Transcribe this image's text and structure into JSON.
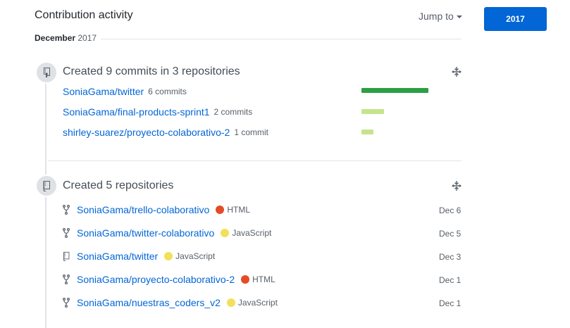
{
  "header": {
    "title": "Contribution activity",
    "jump_label": "Jump to",
    "year_button": "2017"
  },
  "month": {
    "name": "December",
    "year": "2017"
  },
  "commits_section": {
    "title": "Created 9 commits in 3 repositories",
    "items": [
      {
        "repo": "SoniaGama/twitter",
        "count": "6 commits",
        "commits": 6
      },
      {
        "repo": "SoniaGama/final-products-sprint1",
        "count": "2 commits",
        "commits": 2
      },
      {
        "repo": "shirley-suarez/proyecto-colaborativo-2",
        "count": "1 commit",
        "commits": 1
      }
    ],
    "bar_colors": {
      "high": "#2c9f45",
      "low": "#c6e48b"
    }
  },
  "repos_section": {
    "title": "Created 5 repositories",
    "items": [
      {
        "icon": "fork-icon",
        "repo": "SoniaGama/trello-colaborativo",
        "lang": "HTML",
        "lang_color": "#e34c26",
        "date": "Dec 6"
      },
      {
        "icon": "fork-icon",
        "repo": "SoniaGama/twitter-colaborativo",
        "lang": "JavaScript",
        "lang_color": "#f1e05a",
        "date": "Dec 5"
      },
      {
        "icon": "repo-book-icon",
        "repo": "SoniaGama/twitter",
        "lang": "JavaScript",
        "lang_color": "#f1e05a",
        "date": "Dec 3"
      },
      {
        "icon": "fork-icon",
        "repo": "SoniaGama/proyecto-colaborativo-2",
        "lang": "HTML",
        "lang_color": "#e34c26",
        "date": "Dec 1"
      },
      {
        "icon": "fork-icon",
        "repo": "SoniaGama/nuestras_coders_v2",
        "lang": "JavaScript",
        "lang_color": "#f1e05a",
        "date": "Dec 1"
      }
    ]
  }
}
